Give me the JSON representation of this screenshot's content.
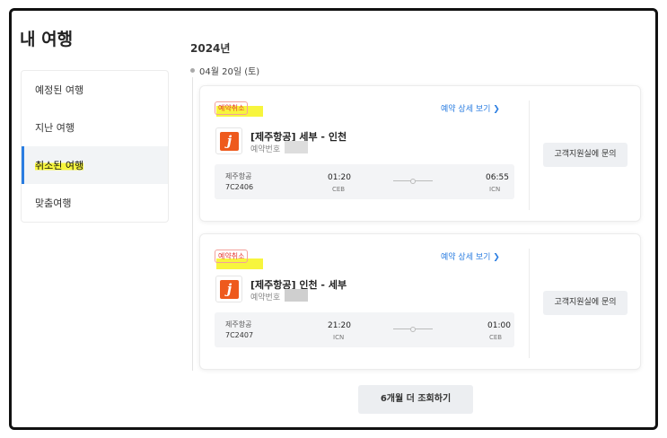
{
  "page": {
    "title": "내 여행"
  },
  "sidebar": {
    "items": [
      {
        "label": "예정된 여행"
      },
      {
        "label": "지난 여행"
      },
      {
        "label": "취소된 여행"
      },
      {
        "label": "맞춤여행"
      }
    ],
    "active_index": 2
  },
  "trips": {
    "year": "2024년",
    "date": "04월 20일 (토)",
    "cards": [
      {
        "status_badge": "예약취소",
        "detail_link": "예약 상세 보기 ❯",
        "route_title": "[제주항공] 세부 - 인천",
        "booking_label": "예약번호",
        "airline": "제주항공",
        "flight_code": "7C2406",
        "depart_time": "01:20",
        "depart_airport": "CEB",
        "arrive_time": "06:55",
        "arrive_airport": "ICN",
        "support_button": "고객지원실에 문의",
        "logo_letter": "j"
      },
      {
        "status_badge": "예약취소",
        "detail_link": "예약 상세 보기 ❯",
        "route_title": "[제주항공] 인천 - 세부",
        "booking_label": "예약번호",
        "airline": "제주항공",
        "flight_code": "7C2407",
        "depart_time": "21:20",
        "depart_airport": "ICN",
        "arrive_time": "01:00",
        "arrive_airport": "CEB",
        "support_button": "고객지원실에 문의",
        "logo_letter": "j"
      }
    ]
  },
  "more_button": "6개월 더 조회하기",
  "colors": {
    "accent": "#2a7de1",
    "cancel_badge": "#e5362f",
    "highlight": "#f7f53d",
    "airline_brand": "#ee5a1d"
  }
}
